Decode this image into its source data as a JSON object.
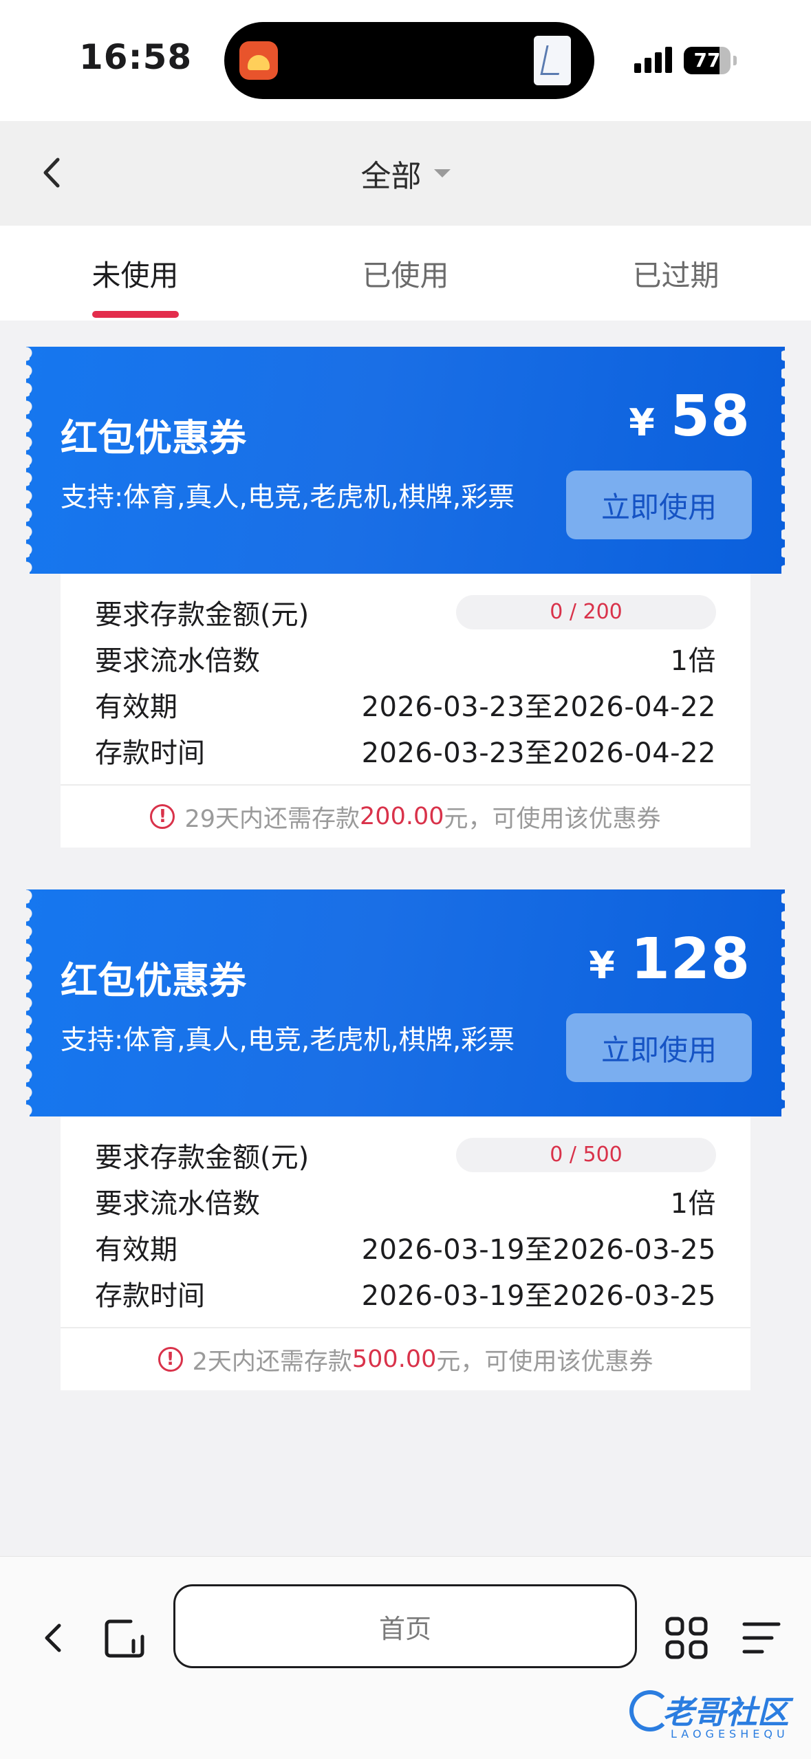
{
  "status_bar": {
    "time": "16:58",
    "battery_level": "77",
    "battery_fraction": 0.77
  },
  "header": {
    "title": "全部"
  },
  "tabs": [
    {
      "label": "未使用",
      "active": true
    },
    {
      "label": "已使用",
      "active": false
    },
    {
      "label": "已过期",
      "active": false
    }
  ],
  "coupons": [
    {
      "name": "红包优惠券",
      "support": "支持:体育,真人,电竞,老虎机,棋牌,彩票",
      "currency": "¥",
      "amount": "58",
      "button": "立即使用",
      "rows": {
        "deposit_label": "要求存款金额(元)",
        "deposit_progress": "0 / 200",
        "turnover_label": "要求流水倍数",
        "turnover_value": "1倍",
        "validity_label": "有效期",
        "validity_value": "2026-03-23至2026-04-22",
        "deposit_time_label": "存款时间",
        "deposit_time_value": "2026-03-23至2026-04-22"
      },
      "notice": {
        "pre": "29天内还需存款",
        "amount": "200.00",
        "post": "元，可使用该优惠券"
      }
    },
    {
      "name": "红包优惠券",
      "support": "支持:体育,真人,电竞,老虎机,棋牌,彩票",
      "currency": "¥",
      "amount": "128",
      "button": "立即使用",
      "rows": {
        "deposit_label": "要求存款金额(元)",
        "deposit_progress": "0 / 500",
        "turnover_label": "要求流水倍数",
        "turnover_value": "1倍",
        "validity_label": "有效期",
        "validity_value": "2026-03-19至2026-03-25",
        "deposit_time_label": "存款时间",
        "deposit_time_value": "2026-03-19至2026-03-25"
      },
      "notice": {
        "pre": "2天内还需存款",
        "amount": "500.00",
        "post": "元，可使用该优惠券"
      }
    }
  ],
  "toolbar": {
    "address": "首页"
  },
  "watermark": {
    "text": "老哥社区",
    "sub": "LAOGESHEQU"
  },
  "icons": [
    "back-chevron-icon",
    "caret-down-icon",
    "warning-icon",
    "tabs-icon",
    "grid-icon",
    "menu-icon"
  ],
  "colors": {
    "accent_red": "#e32d4c",
    "coupon_blue": "#1677ef",
    "button_blue": "#7aaef0"
  }
}
